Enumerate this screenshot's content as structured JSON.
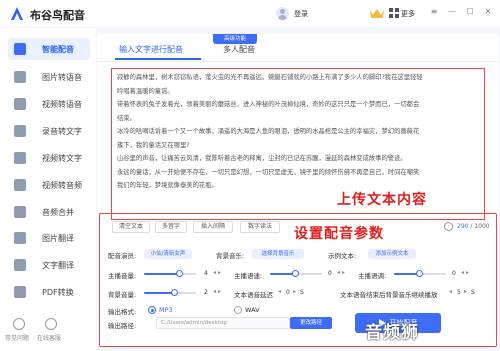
{
  "app": {
    "title": "布谷鸟配音",
    "login": "登录",
    "more": "更多"
  },
  "colors": {
    "accent": "#3d6cf6",
    "annotation": "#e02020"
  },
  "sidebar": {
    "items": [
      {
        "label": "智能配音",
        "icon": "mic-icon"
      },
      {
        "label": "图片转语音",
        "icon": "image-icon"
      },
      {
        "label": "视频转语音",
        "icon": "video-icon"
      },
      {
        "label": "录音转文字",
        "icon": "record-icon"
      },
      {
        "label": "视频转文字",
        "icon": "video-text-icon"
      },
      {
        "label": "视频转音频",
        "icon": "video-audio-icon"
      },
      {
        "label": "音频合并",
        "icon": "merge-icon"
      },
      {
        "label": "图片翻译",
        "icon": "image-translate-icon"
      },
      {
        "label": "文字翻译",
        "icon": "text-translate-icon"
      },
      {
        "label": "PDF转换",
        "icon": "pdf-icon"
      }
    ],
    "bottom": [
      "常见问题",
      "在线客服"
    ]
  },
  "tabs": [
    {
      "label": "输入文字进行配音"
    },
    {
      "label": "多人配音"
    }
  ],
  "highlight_badge": "高级功能",
  "text_content": [
    "寂静的森林里，树木窃窃私语，萤火虫的光不再遥远。蜿蜒石铺就的小路上布满了多少人的脚印?我在这里轻轻",
    "吟唱着温暖的童谣。",
    "带着怀表的兔子发着光，领着美丽的蘑菇丝，进入神秘的叶茂掉仙境，奇妙的这只只是一个梦而已，一切都会",
    "结束。",
    "冰冷的啥嘀话诉着一个又一个故事，涌遥的大海是人鱼的眼泪，透明的水晶棺是公主的幸福灾，梦幻的蔷薇花",
    "簇下，我的童话又在哪里?",
    "山谷里的声音，让痛苦云风清，我陈听着古老的释寓，尘封的已记在苏醒，漫延的森林变成故事的警迹。",
    "永远的童话，从一开始便不存在，一切只是幻想，一切只是虚无，镜子里的倾怀伤佛不再是自己，时间在嘲笑",
    "我们的年轻，梦境就像泰美的花瓶。"
  ],
  "annotations": {
    "upload": "上传文本内容",
    "settings": "设置配音参数"
  },
  "toolbar": {
    "clear": "清空文本",
    "polyphone": "多音字",
    "pause": "插入间隔",
    "number": "数字读法"
  },
  "counter": {
    "current": "290",
    "max": "/ 1000"
  },
  "params": {
    "voice_label": "配音演员:",
    "voice_value": "小仙/清新女声",
    "bgm_label": "背景音乐:",
    "bgm_value": "选择背景音乐",
    "sample_label": "示例文本:",
    "sample_value": "添加示例文本",
    "main_volume_label": "主播音量:",
    "main_volume": 4,
    "main_speed_label": "主播语速:",
    "main_speed": 0,
    "main_pitch_label": "主播语调:",
    "main_pitch": 0,
    "bg_volume_label": "背景音量:",
    "bg_volume": 2,
    "delay_label": "文本语音延迟",
    "delay_value": 0,
    "delay_unit": "S",
    "bg_tail_label": "文本语音结束后背景音乐继续播放",
    "bg_tail_value": 5,
    "bg_tail_unit": "S",
    "format_label": "输出格式:",
    "format_mp3": "MP3",
    "format_wav": "WAV",
    "path_label": "输出路径:",
    "path_value": "C:/Users/admin/desktop",
    "path_button": "更改路径",
    "start_button": "开始配音"
  },
  "watermark": "音频狮"
}
